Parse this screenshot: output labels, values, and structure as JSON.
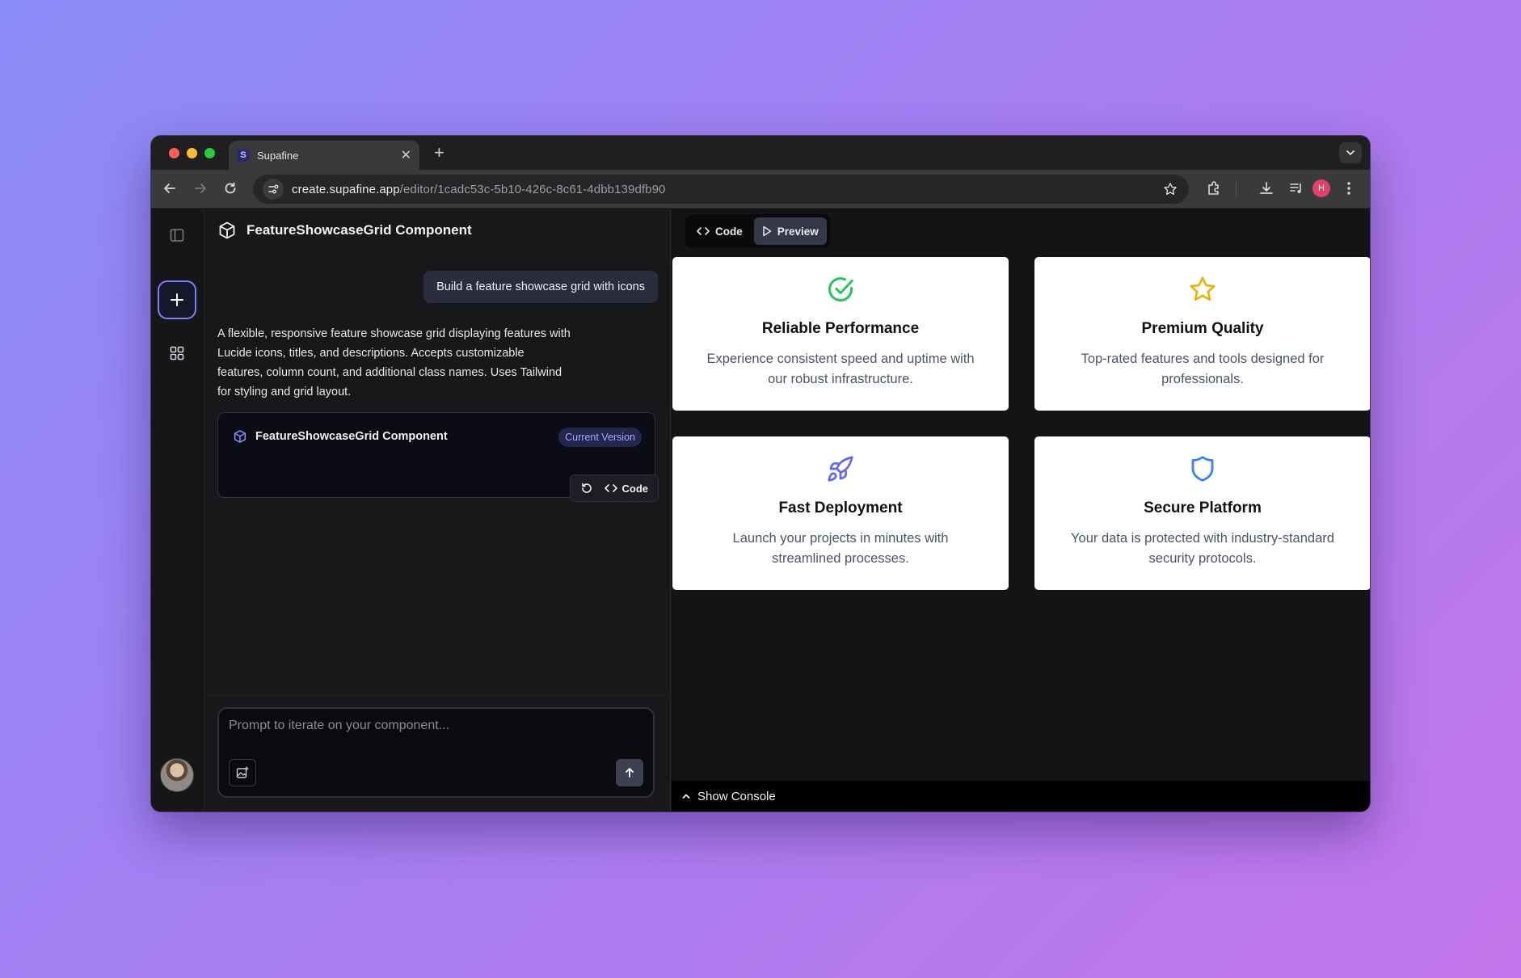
{
  "browser": {
    "tab_title": "Supafine",
    "tab_favicon_letter": "S",
    "url_host": "create.supafine.app",
    "url_path": "/editor/1cadc53c-5b10-426c-8c61-4dbb139dfb90",
    "profile_initial": "H",
    "colors": {
      "close": "#ff5f57",
      "minimize": "#febc2e",
      "zoom": "#28c840",
      "profile": "#e0406a"
    }
  },
  "chat": {
    "header_title": "FeatureShowcaseGrid Component",
    "user_message": "Build a feature showcase grid with icons",
    "assistant_message": "A flexible, responsive feature showcase grid displaying features with Lucide icons, titles, and descriptions. Accepts customizable features, column count, and additional class names. Uses Tailwind for styling and grid layout.",
    "version_card": {
      "title": "FeatureShowcaseGrid Component",
      "badge": "Current Version",
      "code_label": "Code"
    },
    "composer_placeholder": "Prompt to iterate on your component..."
  },
  "preview": {
    "toggle": {
      "code_label": "Code",
      "preview_label": "Preview",
      "active": "Preview"
    },
    "features": [
      {
        "icon": "circle-check-icon",
        "color": "#22c55e",
        "title": "Reliable Performance",
        "description": "Experience consistent speed and uptime with our robust infrastructure."
      },
      {
        "icon": "star-icon",
        "color": "#eab308",
        "title": "Premium Quality",
        "description": "Top-rated features and tools designed for professionals."
      },
      {
        "icon": "rocket-icon",
        "color": "#6366f1",
        "title": "Fast Deployment",
        "description": "Launch your projects in minutes with streamlined processes."
      },
      {
        "icon": "shield-icon",
        "color": "#3b82f6",
        "title": "Secure Platform",
        "description": "Your data is protected with industry-standard security protocols."
      }
    ],
    "console_label": "Show Console"
  }
}
